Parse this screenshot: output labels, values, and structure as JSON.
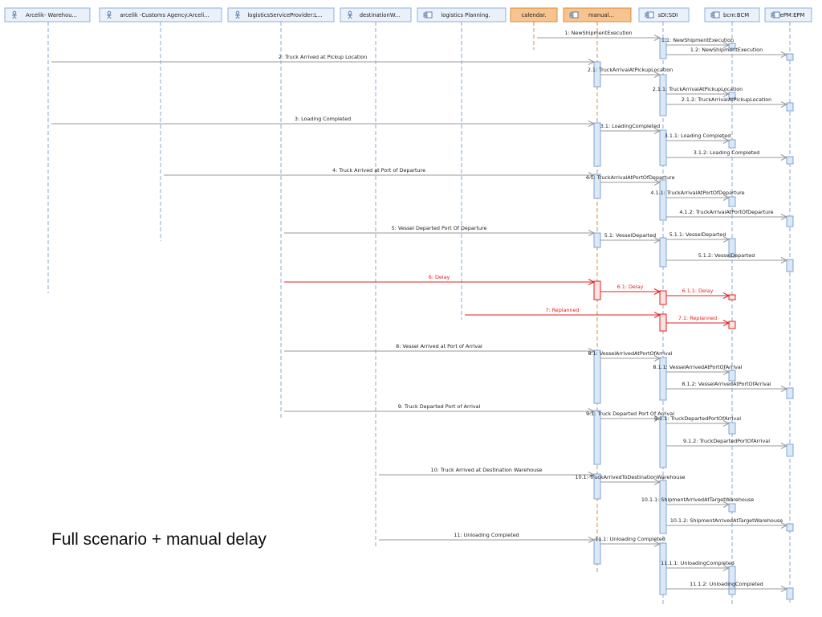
{
  "caption": "Full scenario + manual delay",
  "colors": {
    "line": "#9a9a9a",
    "lifeline": "#88aad0",
    "activation_fill": "#dbe8f7",
    "activation_stroke": "#7fa6d4",
    "header_fill": "#eaf1fa",
    "header_stroke": "#8fb0d6",
    "highlight_fill": "#f7c490",
    "highlight_stroke": "#d98c3a",
    "highlight_lifeline": "#d98c3a",
    "red": "#e02020",
    "red_fill": "#fbe3e3"
  },
  "participants": [
    {
      "id": "p1",
      "label": "Arcelik- Warehou...",
      "kind": "actor"
    },
    {
      "id": "p2",
      "label": "arcelik -Customs Agency:Arceli...",
      "kind": "actor"
    },
    {
      "id": "p3",
      "label": "logisticsServiceProvider:L...",
      "kind": "actor"
    },
    {
      "id": "p4",
      "label": "destinationW...",
      "kind": "actor"
    },
    {
      "id": "p5",
      "label": "logistics Planning.",
      "kind": "component"
    },
    {
      "id": "p6",
      "label": "calendar.",
      "kind": "plain",
      "highlight": true
    },
    {
      "id": "p7",
      "label": "manual...",
      "kind": "component",
      "highlight": true
    },
    {
      "id": "p8",
      "label": "sDI:SDI",
      "kind": "component"
    },
    {
      "id": "p9",
      "label": "bcm:BCM",
      "kind": "component"
    },
    {
      "id": "p10",
      "label": "ePM:EPM",
      "kind": "component"
    }
  ],
  "messages": [
    {
      "label": "1: NewShipmentExecution",
      "from": "p6",
      "to": "p8"
    },
    {
      "label": "1.1: NewShipmentExecution",
      "from": "p8",
      "to": "p9"
    },
    {
      "label": "1.2: NewShipmentExecution",
      "from": "p8",
      "to": "p10"
    },
    {
      "label": "2: Truck Arrived at Pickup Location",
      "from": "p1",
      "to": "p7"
    },
    {
      "label": "2.1: TruckArrivalAtPickupLocation",
      "from": "p7",
      "to": "p8"
    },
    {
      "label": "2.1.1: TruckArrivalAtPickupLocation",
      "from": "p8",
      "to": "p9"
    },
    {
      "label": "2.1.2: TruckArrivalAtPickupLocation",
      "from": "p8",
      "to": "p10"
    },
    {
      "label": "3: Loading Completed",
      "from": "p1",
      "to": "p7"
    },
    {
      "label": "3.1: LoadingCompleted",
      "from": "p7",
      "to": "p8"
    },
    {
      "label": "3.1.1: Loading Completed",
      "from": "p8",
      "to": "p9"
    },
    {
      "label": "3.1.2: Loading Completed",
      "from": "p8",
      "to": "p10"
    },
    {
      "label": "4: Truck Arrived at Port of Departure",
      "from": "p2",
      "to": "p7"
    },
    {
      "label": "4.1: TruckArrivalAtPortOfDeparture",
      "from": "p7",
      "to": "p8"
    },
    {
      "label": "4.1.1: TruckArrivalAtPortOfDeparture",
      "from": "p8",
      "to": "p9"
    },
    {
      "label": "4.1.2: TruckArrivalAtPortOfDeparture",
      "from": "p8",
      "to": "p10"
    },
    {
      "label": "5: Vessel Departed Port Of Departure",
      "from": "p3",
      "to": "p7"
    },
    {
      "label": "5.1: VesselDeparted",
      "from": "p7",
      "to": "p8"
    },
    {
      "label": "5.1.1: VesselDeparted",
      "from": "p8",
      "to": "p9"
    },
    {
      "label": "5.1.2: VesselDeparted",
      "from": "p8",
      "to": "p10"
    },
    {
      "label": "6: Delay",
      "from": "p3",
      "to": "p7",
      "red": true
    },
    {
      "label": "6.1: Delay",
      "from": "p7",
      "to": "p8",
      "red": true
    },
    {
      "label": "6.1.1: Delay",
      "from": "p8",
      "to": "p9",
      "red": true
    },
    {
      "label": "7: Replanned",
      "from": "p5",
      "to": "p8",
      "red": true
    },
    {
      "label": "7.1: Replanned",
      "from": "p8",
      "to": "p9",
      "red": true
    },
    {
      "label": "8: Vessel Arrived at Port of Arrival",
      "from": "p3",
      "to": "p7"
    },
    {
      "label": "8.1: VesselArrivedAtPortOfArrival",
      "from": "p7",
      "to": "p8"
    },
    {
      "label": "8.1.1: VesselArrivedAtPortOfArrival",
      "from": "p8",
      "to": "p9"
    },
    {
      "label": "8.1.2: VesselArrivedAtPortOfArrival",
      "from": "p8",
      "to": "p10"
    },
    {
      "label": "9: Truck Departed Port of Arrival",
      "from": "p3",
      "to": "p7"
    },
    {
      "label": "9.1: Truck Departed Port Of Arrival",
      "from": "p7",
      "to": "p8"
    },
    {
      "label": "9.1.1: TruckDepartedPortOfArrival",
      "from": "p8",
      "to": "p9"
    },
    {
      "label": "9.1.2: TruckDepartedPortOfArrival",
      "from": "p8",
      "to": "p10"
    },
    {
      "label": "10: Truck Arrived at Destination Warehouse",
      "from": "p4",
      "to": "p7"
    },
    {
      "label": "10.1: TruckArrivedToDestinationWarehouse",
      "from": "p7",
      "to": "p8"
    },
    {
      "label": "10.1.1: ShipmentArrivedAtTargetWarehouse",
      "from": "p8",
      "to": "p9"
    },
    {
      "label": "10.1.2: ShipmentArrivedAtTargetWarehouse",
      "from": "p8",
      "to": "p10"
    },
    {
      "label": "11: Unloading Completed",
      "from": "p4",
      "to": "p7"
    },
    {
      "label": "11.1: Unloading Completed",
      "from": "p7",
      "to": "p8"
    },
    {
      "label": "11.1.1: UnloadingCompleted",
      "from": "p8",
      "to": "p9"
    },
    {
      "label": "11.1.2: UnloadingCompleted",
      "from": "p8",
      "to": "p10"
    }
  ]
}
